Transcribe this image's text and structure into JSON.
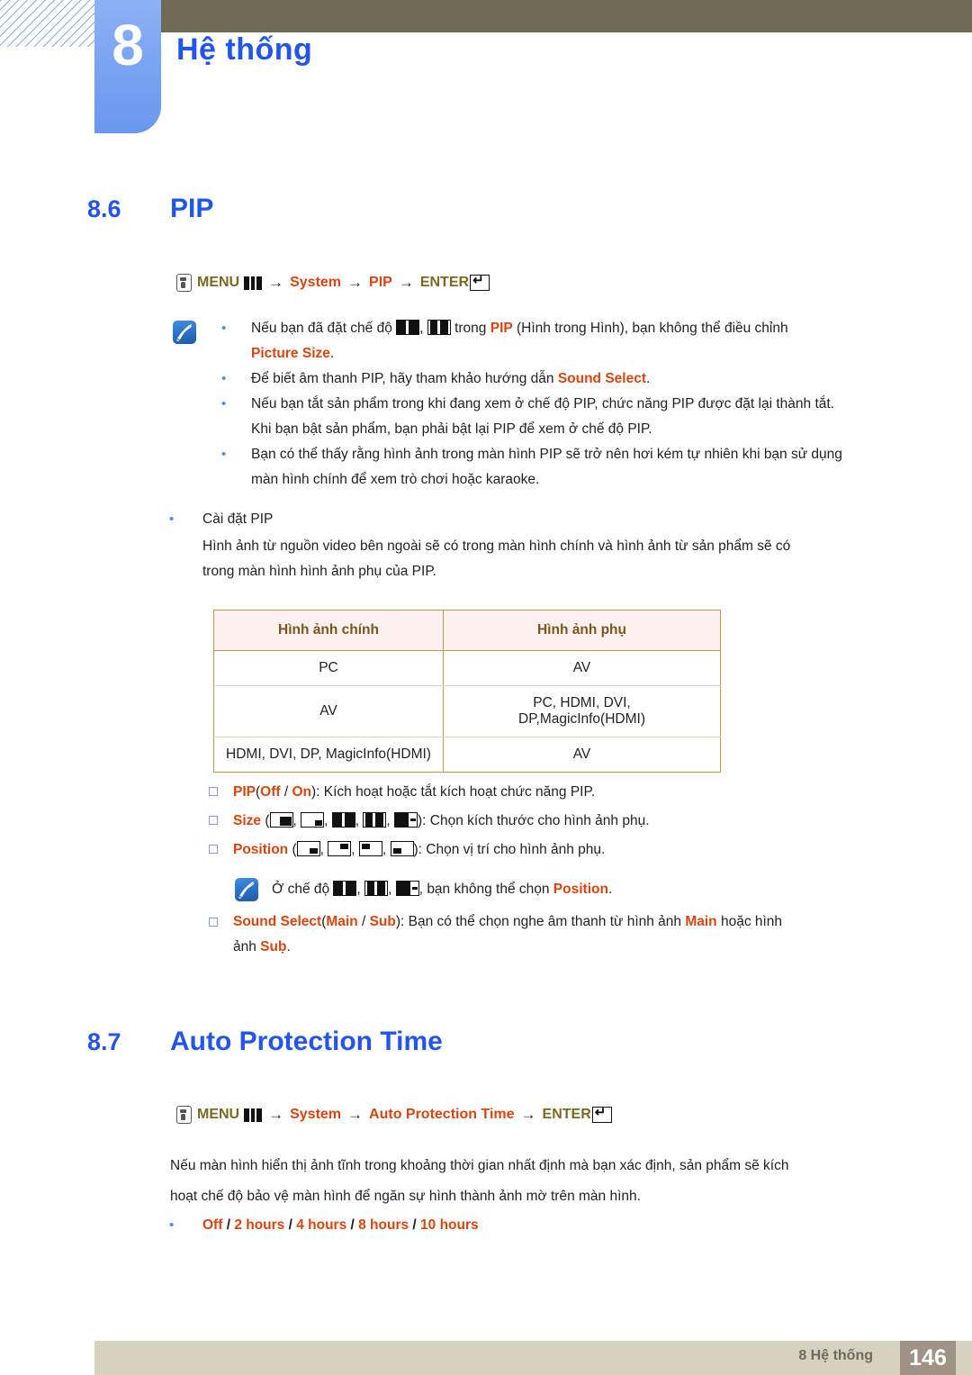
{
  "header": {
    "chapter_number": "8",
    "chapter_title": "Hệ thống"
  },
  "sections": [
    {
      "number": "8.6",
      "title": "PIP",
      "menu_path": {
        "menu_label": "MENU",
        "arrow": "→",
        "items": [
          "System",
          "PIP"
        ],
        "enter_label": "ENTER"
      }
    },
    {
      "number": "8.7",
      "title": "Auto Protection Time",
      "menu_path": {
        "menu_label": "MENU",
        "arrow": "→",
        "items": [
          "System",
          "Auto Protection Time"
        ],
        "enter_label": "ENTER"
      }
    }
  ],
  "note_block_1": {
    "bullets": [
      {
        "line1_pre": "Nếu bạn đã đặt chế độ ",
        "line1_mid": ", ",
        "line1_post": " trong ",
        "strong1": "PIP",
        "line1_tail": " (Hình trong Hình), bạn không thể điều chỉnh",
        "line2_strong": "Picture Size",
        "line2_tail": "."
      },
      {
        "text_pre": "Để biết âm thanh PIP, hãy tham khảo hướng dẫn ",
        "strong": "Sound Select",
        "text_post": "."
      },
      {
        "line1": "Nếu bạn tắt sản phẩm trong khi đang xem ở chế độ PIP, chức năng PIP được đặt lại thành tắt.",
        "line2": "Khi bạn bật sản phẩm, bạn phải bật lại PIP để xem ở chế độ PIP."
      },
      {
        "line1": "Bạn có thể thấy rằng hình ảnh trong màn hình PIP sẽ trở nên hơi kém tự nhiên khi bạn sử dụng",
        "line2": "màn hình chính để xem trò chơi hoặc karaoke."
      }
    ]
  },
  "pip_settings": {
    "bullet_label": "Cài đặt PIP",
    "paragraph_line1": "Hình ảnh từ nguồn video bên ngoài sẽ có trong màn hình chính và hình ảnh từ sản phẩm sẽ có",
    "paragraph_line2": "trong màn hình hình ảnh phụ của PIP."
  },
  "table": {
    "headers": [
      "Hình ảnh chính",
      "Hình ảnh phụ"
    ],
    "rows": [
      {
        "main": "PC",
        "sub_line1": "AV",
        "sub_line2": ""
      },
      {
        "main": "AV",
        "sub_line1": "PC, HDMI, DVI,",
        "sub_line2": "DP,MagicInfo(HDMI)"
      },
      {
        "main": "HDMI, DVI, DP, MagicInfo(HDMI)",
        "sub_line1": "AV",
        "sub_line2": ""
      }
    ]
  },
  "options": {
    "pip": {
      "name": "PIP",
      "open_paren": "(",
      "off": "Off",
      "slash": " / ",
      "on": "On",
      "close_paren": ")",
      "description": ": Kích hoạt hoặc tắt kích hoạt chức năng PIP."
    },
    "size": {
      "name": "Size",
      "open_paren": "(",
      "comma": ", ",
      "close_paren": ")",
      "description": ": Chọn kích thước cho hình ảnh phụ.",
      "icons": [
        "pip-size-large-br-icon",
        "pip-size-small-br-icon",
        "pip-size-split-half-icon",
        "pip-size-split-blocks-icon",
        "pip-size-dash-right-icon"
      ]
    },
    "position": {
      "name": "Position",
      "open_paren": "(",
      "comma": ", ",
      "close_paren": ")",
      "description": ": Chọn vị trí cho hình ảnh phụ.",
      "icons": [
        "pip-pos-bottom-right-icon",
        "pip-pos-top-right-icon",
        "pip-pos-top-left-icon",
        "pip-pos-bottom-left-icon"
      ]
    },
    "sound_select": {
      "name": "Sound Select",
      "open_paren": "(",
      "main": "Main",
      "slash": " / ",
      "sub": "Sub",
      "close_paren": ")",
      "description_line1": ": Bạn có thể chọn nghe âm thanh từ hình ảnh ",
      "main_inline": "Main",
      "description_line1_tail": " hoặc hình",
      "description_line2_pre": "ảnh ",
      "sub_inline": "Suḅ",
      "description_line2_tail": "."
    }
  },
  "note_block_2": {
    "text_pre": "Ở chế độ ",
    "comma": ", ",
    "text_mid": ", bạn không thể chọn ",
    "strong": "Position",
    "text_post": "."
  },
  "auto_protection": {
    "paragraph_line1": "Nếu màn hình hiển thị ảnh tĩnh trong khoảng thời gian nhất định mà bạn xác định, sản phẩm sẽ kích",
    "paragraph_line2": "hoạt chế độ bảo vệ màn hình để ngăn sự hình thành ảnh mờ trên màn hình.",
    "options_line": {
      "off": "Off",
      "sep1": " / ",
      "h2": "2 hours",
      "sep2": " / ",
      "h4": "4 hours",
      "sep3": " / ",
      "h8": "8 hours",
      "sep4": " / ",
      "h10": "10 hours"
    }
  },
  "footer": {
    "label": "8 Hệ thống",
    "page_number": "146"
  },
  "colors": {
    "heading_blue": "#2255ee",
    "accent_red": "#d9450f",
    "olive": "#7a6a1f",
    "olive_bar": "#6f6a53",
    "table_border": "#b99a4e",
    "table_header_bg": "#fdf1ef",
    "footer_bar": "#d6d2bf",
    "footer_page_bg": "#9e9385"
  }
}
